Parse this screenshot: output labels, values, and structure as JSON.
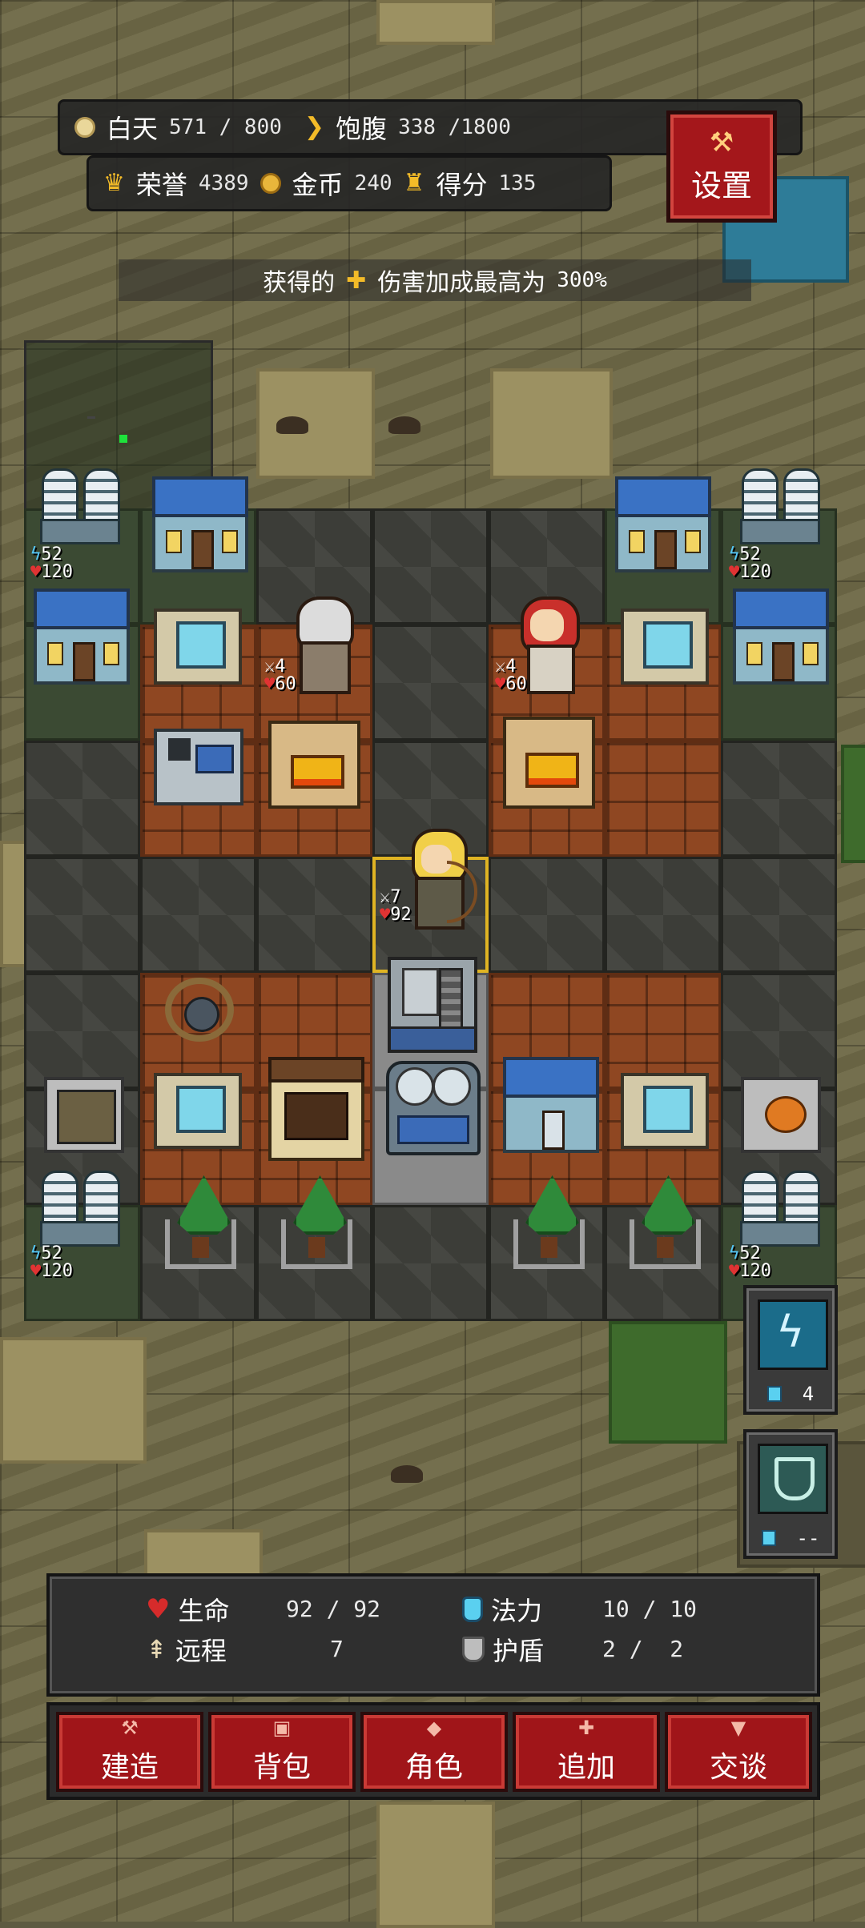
{
  "hud": {
    "day_label": "白天",
    "day_value": "571 / 800",
    "hunger_label": "饱腹",
    "hunger_value": "338 /1800",
    "honor_label": "荣誉",
    "honor_value": "4389",
    "gold_label": "金币",
    "gold_value": "240",
    "score_label": "得分",
    "score_value": "135",
    "settings_label": "设置"
  },
  "notice": {
    "prefix": "获得的",
    "suffix": "伤害加成最高为",
    "percent": "300%"
  },
  "board": {
    "towers": [
      {
        "energy": "52",
        "hp": "120"
      },
      {
        "energy": "52",
        "hp": "120"
      },
      {
        "energy": "52",
        "hp": "120"
      },
      {
        "energy": "52",
        "hp": "120"
      }
    ],
    "characters": [
      {
        "name": "old-sage",
        "attack": "4",
        "hp": "60"
      },
      {
        "name": "red-hood-girl",
        "attack": "4",
        "hp": "60"
      },
      {
        "name": "archer-girl",
        "attack": "7",
        "hp": "92"
      }
    ]
  },
  "skills": [
    {
      "icon": "lightning-skill-icon",
      "cost": "4"
    },
    {
      "icon": "shield-skill-icon",
      "cost": "--"
    }
  ],
  "stats": {
    "life_label": "生命",
    "life_value": "92 / 92",
    "mana_label": "法力",
    "mana_value": "10 / 10",
    "range_label": "远程",
    "range_value": "7",
    "shield_label": "护盾",
    "shield_value": "2 /  2"
  },
  "actions": [
    {
      "label": "建造",
      "icon": "hammer-icon"
    },
    {
      "label": "背包",
      "icon": "bag-icon"
    },
    {
      "label": "角色",
      "icon": "character-icon"
    },
    {
      "label": "追加",
      "icon": "plus-icon"
    },
    {
      "label": "交谈",
      "icon": "chat-icon"
    }
  ],
  "colors": {
    "button_red": "#a01519",
    "panel_dark": "#2f2f2f",
    "heart": "#e03333",
    "mana": "#54c6f7",
    "gold": "#f3bb28"
  }
}
